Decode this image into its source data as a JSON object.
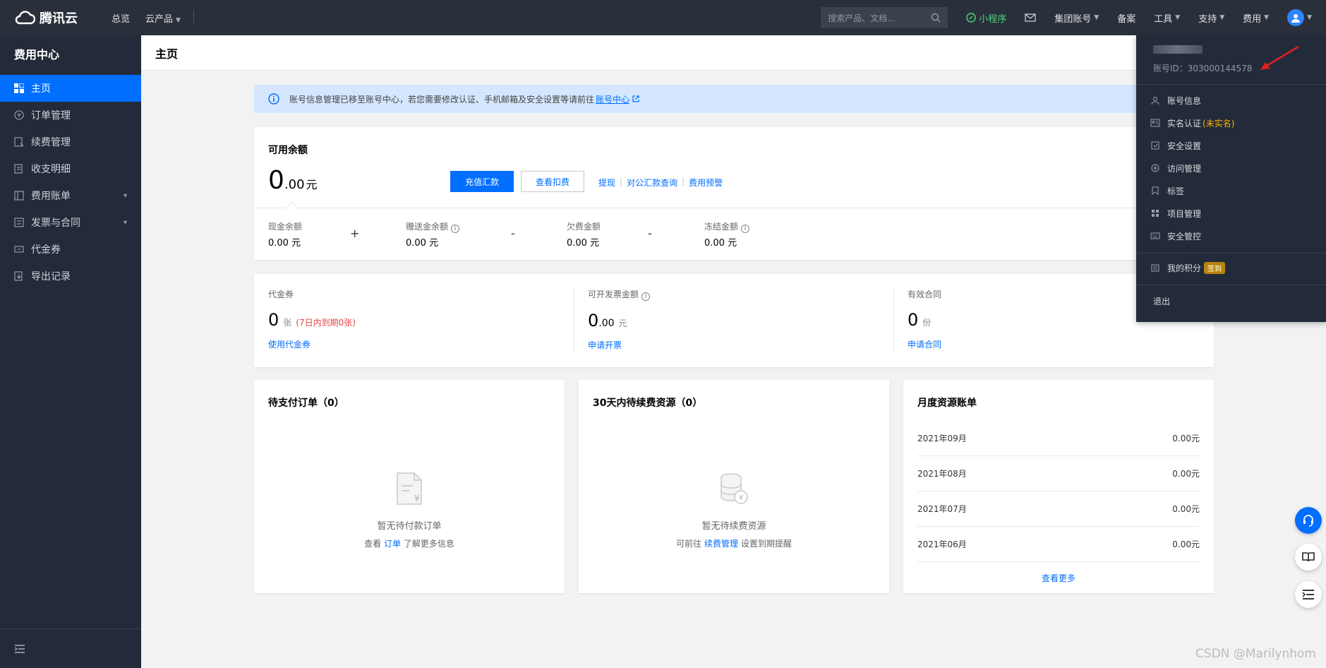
{
  "topbar": {
    "logo_text": "腾讯云",
    "nav": [
      "总览",
      "云产品"
    ],
    "search_placeholder": "搜索产品、文档...",
    "mini_program": "小程序",
    "right_items": [
      "集团账号",
      "备案",
      "工具",
      "支持",
      "费用"
    ]
  },
  "sidebar": {
    "title": "费用中心",
    "items": [
      {
        "label": "主页",
        "icon": "grid-icon"
      },
      {
        "label": "订单管理",
        "icon": "yen-circle-icon"
      },
      {
        "label": "续费管理",
        "icon": "renew-icon"
      },
      {
        "label": "收支明细",
        "icon": "list-icon"
      },
      {
        "label": "费用账单",
        "icon": "bill-icon"
      },
      {
        "label": "发票与合同",
        "icon": "invoice-icon"
      },
      {
        "label": "代金券",
        "icon": "voucher-icon"
      },
      {
        "label": "导出记录",
        "icon": "export-icon"
      }
    ]
  },
  "page": {
    "title": "主页"
  },
  "notice": {
    "text": "账号信息管理已移至账号中心，若您需要修改认证、手机邮箱及安全设置等请前往",
    "link": "账号中心"
  },
  "balance": {
    "title": "可用余额",
    "amount_int": "0",
    "amount_dec": ".00",
    "unit": "元",
    "recharge_btn": "充值汇款",
    "deduct_btn": "查看扣费",
    "links": [
      "提现",
      "对公汇款查询",
      "费用预警"
    ],
    "parts": [
      {
        "label": "现金余额",
        "value": "0.00 元"
      },
      {
        "label": "赠送金余额",
        "value": "0.00 元"
      },
      {
        "label": "欠费金额",
        "value": "0.00 元"
      },
      {
        "label": "冻结金额",
        "value": "0.00 元"
      }
    ],
    "ops": [
      "+",
      "-",
      "-"
    ]
  },
  "stats": [
    {
      "label": "代金券",
      "value": "0",
      "unit": "张",
      "note": "(7日内到期0张)",
      "link": "使用代金券"
    },
    {
      "label": "可开发票金额",
      "value": "0",
      "dec": ".00",
      "unit": "元",
      "link": "申请开票"
    },
    {
      "label": "有效合同",
      "value": "0",
      "unit": "份",
      "link": "申请合同"
    }
  ],
  "pending_orders": {
    "title": "待支付订单（0）",
    "empty": "暂无待付款订单",
    "sub_prefix": "查看",
    "sub_link": "订单",
    "sub_suffix": "了解更多信息"
  },
  "renew": {
    "title": "30天内待续费资源（0）",
    "empty": "暂无待续费资源",
    "sub_prefix": "可前往",
    "sub_link": "续费管理",
    "sub_suffix": "设置到期提醒"
  },
  "monthly": {
    "title": "月度资源账单",
    "rows": [
      {
        "month": "2021年09月",
        "amount": "0.00元"
      },
      {
        "month": "2021年08月",
        "amount": "0.00元"
      },
      {
        "month": "2021年07月",
        "amount": "0.00元"
      },
      {
        "month": "2021年06月",
        "amount": "0.00元"
      }
    ],
    "more": "查看更多"
  },
  "account_menu": {
    "account_id": "账号ID：303000144578",
    "items": [
      {
        "label": "账号信息",
        "icon": "user-icon"
      },
      {
        "label": "实名认证",
        "tag": "(未实名)",
        "icon": "id-card-icon"
      },
      {
        "label": "安全设置",
        "icon": "shield-icon"
      },
      {
        "label": "访问管理",
        "icon": "access-icon"
      },
      {
        "label": "标签",
        "icon": "bookmark-icon"
      },
      {
        "label": "项目管理",
        "icon": "project-icon"
      },
      {
        "label": "安全管控",
        "icon": "keyboard-icon"
      }
    ],
    "points": {
      "label": "我的积分",
      "badge": "签到"
    },
    "logout": "退出"
  },
  "watermark": "CSDN @Marilynhom",
  "colors": {
    "accent": "#006eff",
    "topbar": "#2a303b",
    "sidebar": "#232b3a",
    "warning": "#e54545"
  }
}
